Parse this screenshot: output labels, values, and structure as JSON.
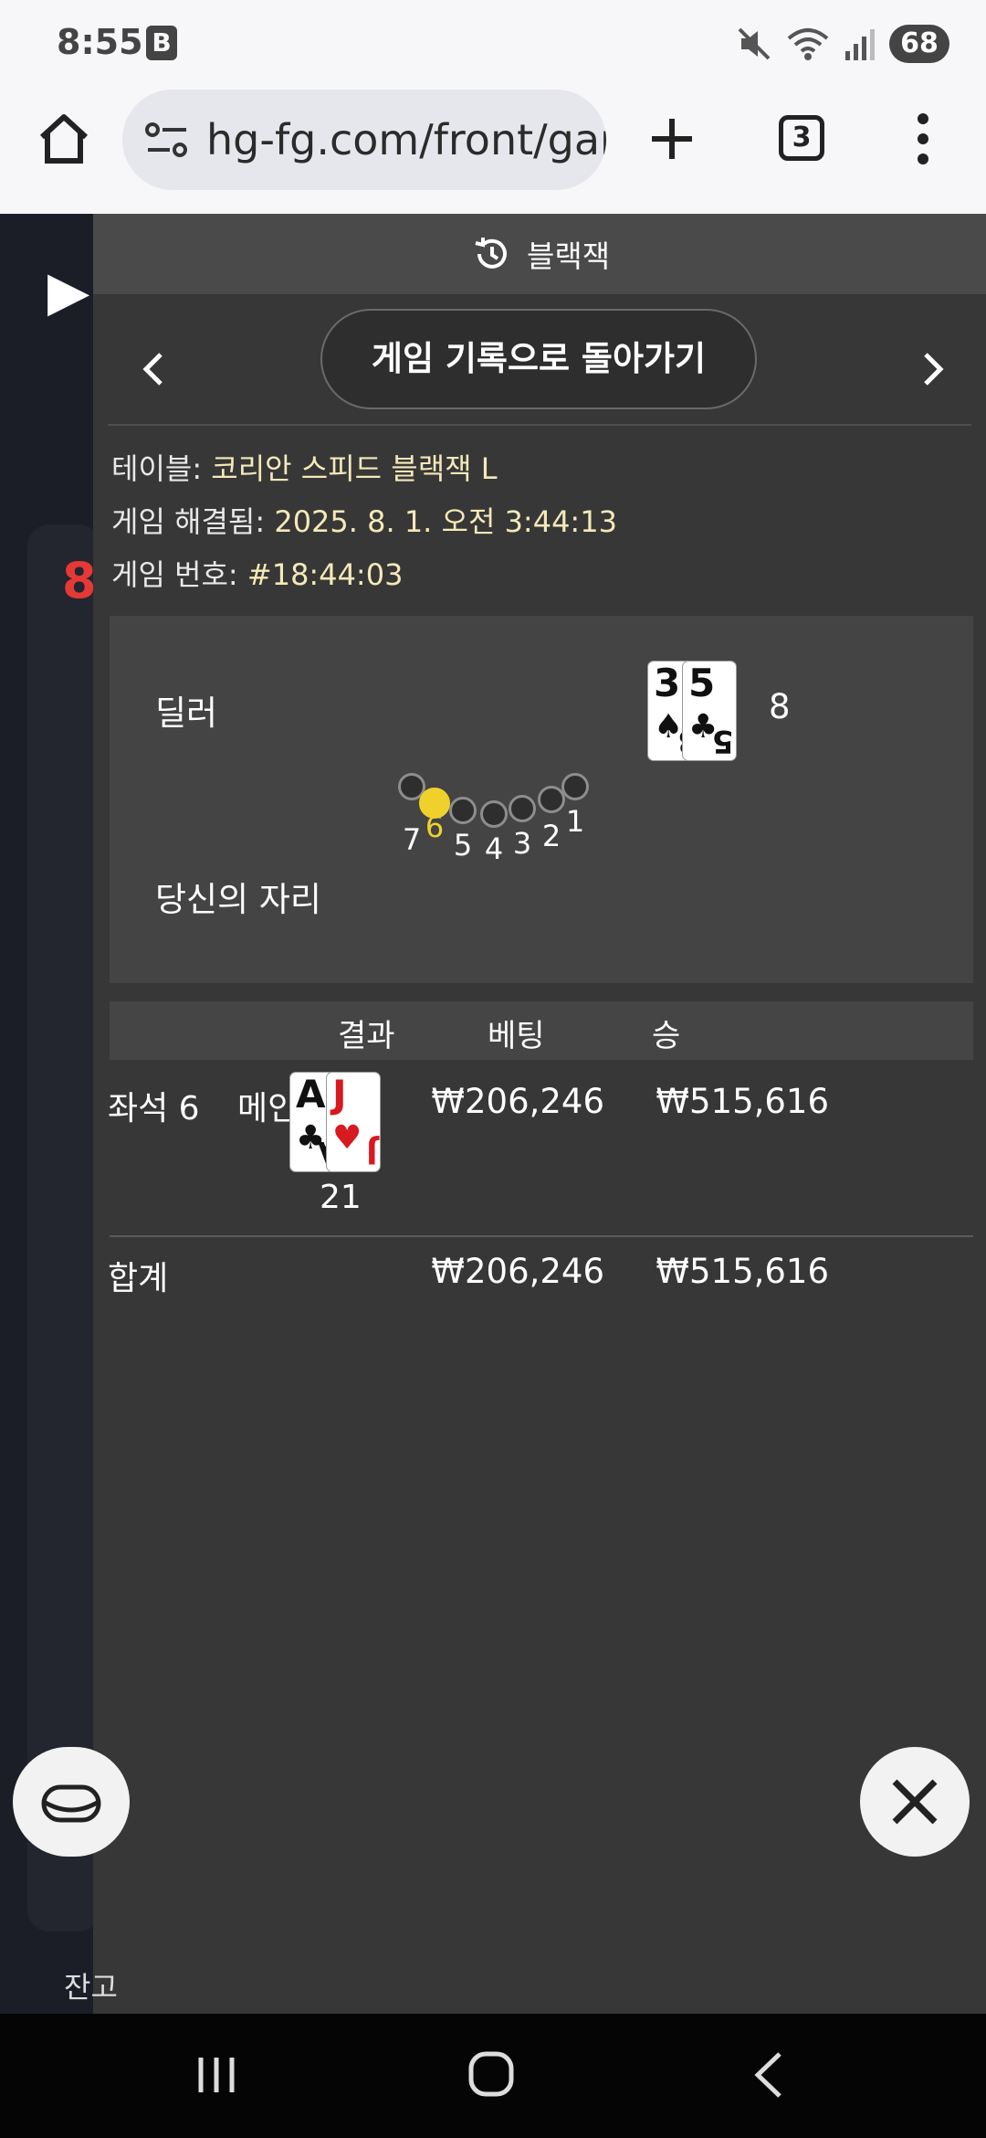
{
  "status_bar": {
    "time": "8:55",
    "b_label": "B",
    "battery": "68"
  },
  "browser": {
    "url": "hg-fg.com/front/gam",
    "tab_count": "3"
  },
  "background": {
    "logo_text": "▶",
    "balance_label": "잔고"
  },
  "panel": {
    "title": "블랙잭",
    "back_button": "게임 기록으로 돌아가기",
    "table_label": "테이블: ",
    "table_value": "코리안 스피드 블랙잭 L",
    "resolved_label": "게임 해결됨: ",
    "resolved_value": "2025. 8. 1. 오전 3:44:13",
    "game_no_label": "게임 번호: ",
    "game_no_value": "#18:44:03",
    "dealer_label": "딜러",
    "dealer_cards": [
      {
        "rank": "3",
        "suit": "♠",
        "color": "#111111"
      },
      {
        "rank": "5",
        "suit": "♣",
        "color": "#111111"
      }
    ],
    "dealer_total": "8",
    "seat_label": "당신의 자리",
    "seats": [
      "7",
      "6",
      "5",
      "4",
      "3",
      "2",
      "1"
    ],
    "active_seat": "6",
    "columns": {
      "result": "결과",
      "bet": "베팅",
      "win": "승"
    },
    "rows": [
      {
        "seat": "좌석 6",
        "bet_type": "메인 베팅",
        "cards": [
          {
            "rank": "A",
            "suit": "♣",
            "color": "#111111"
          },
          {
            "rank": "J",
            "suit": "♥",
            "color": "#d71920"
          }
        ],
        "total": "21",
        "bet": "₩206,246",
        "win": "₩515,616"
      }
    ],
    "sum_label": "합계",
    "sum_bet": "₩206,246",
    "sum_win": "₩515,616"
  }
}
